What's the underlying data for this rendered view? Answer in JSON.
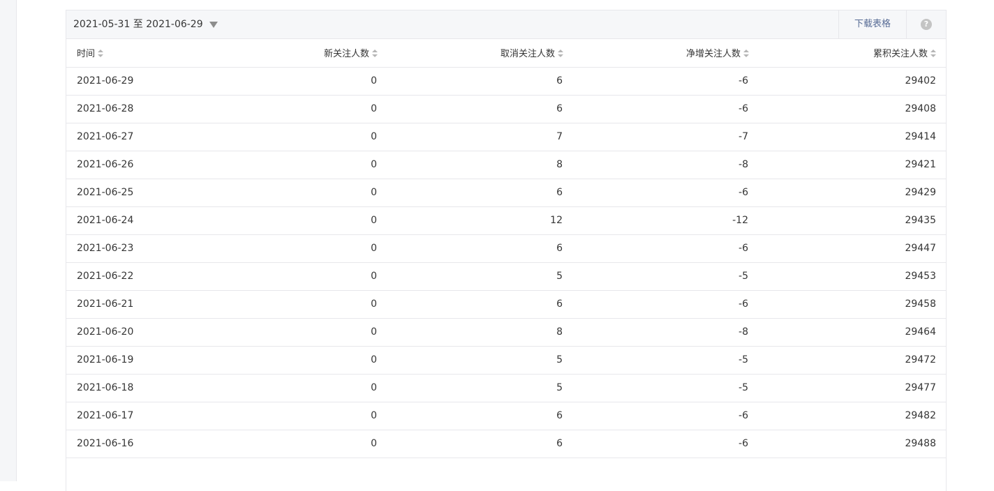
{
  "toolbar": {
    "date_range": "2021-05-31 至 2021-06-29",
    "download_label": "下载表格",
    "help_icon": "question-circle-icon"
  },
  "table": {
    "headers": {
      "time": "时间",
      "new": "新关注人数",
      "cancel": "取消关注人数",
      "net": "净增关注人数",
      "total": "累积关注人数"
    },
    "rows": [
      {
        "time": "2021-06-29",
        "new": "0",
        "cancel": "6",
        "net": "-6",
        "total": "29402"
      },
      {
        "time": "2021-06-28",
        "new": "0",
        "cancel": "6",
        "net": "-6",
        "total": "29408"
      },
      {
        "time": "2021-06-27",
        "new": "0",
        "cancel": "7",
        "net": "-7",
        "total": "29414"
      },
      {
        "time": "2021-06-26",
        "new": "0",
        "cancel": "8",
        "net": "-8",
        "total": "29421"
      },
      {
        "time": "2021-06-25",
        "new": "0",
        "cancel": "6",
        "net": "-6",
        "total": "29429"
      },
      {
        "time": "2021-06-24",
        "new": "0",
        "cancel": "12",
        "net": "-12",
        "total": "29435"
      },
      {
        "time": "2021-06-23",
        "new": "0",
        "cancel": "6",
        "net": "-6",
        "total": "29447"
      },
      {
        "time": "2021-06-22",
        "new": "0",
        "cancel": "5",
        "net": "-5",
        "total": "29453"
      },
      {
        "time": "2021-06-21",
        "new": "0",
        "cancel": "6",
        "net": "-6",
        "total": "29458"
      },
      {
        "time": "2021-06-20",
        "new": "0",
        "cancel": "8",
        "net": "-8",
        "total": "29464"
      },
      {
        "time": "2021-06-19",
        "new": "0",
        "cancel": "5",
        "net": "-5",
        "total": "29472"
      },
      {
        "time": "2021-06-18",
        "new": "0",
        "cancel": "5",
        "net": "-5",
        "total": "29477"
      },
      {
        "time": "2021-06-17",
        "new": "0",
        "cancel": "6",
        "net": "-6",
        "total": "29482"
      },
      {
        "time": "2021-06-16",
        "new": "0",
        "cancel": "6",
        "net": "-6",
        "total": "29488"
      }
    ]
  },
  "colors": {
    "link": "#576b95",
    "border": "#e7e7eb",
    "toolbar_bg": "#f6f7f9",
    "text": "#353535"
  }
}
